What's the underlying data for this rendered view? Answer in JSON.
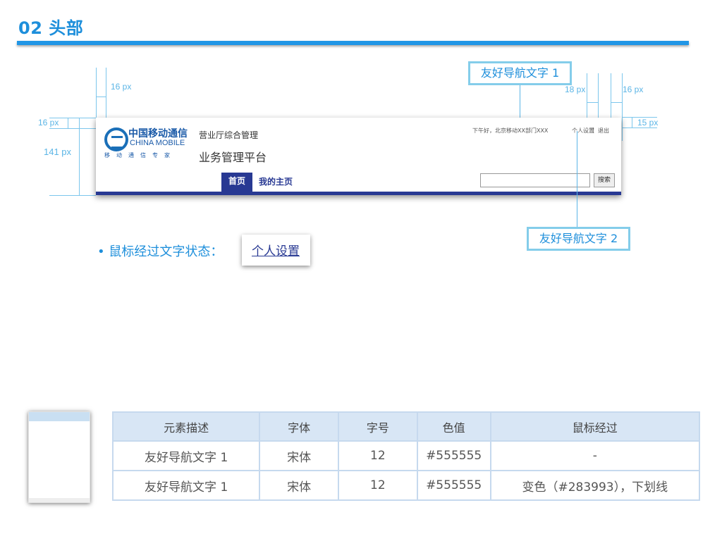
{
  "section": {
    "title": "02 头部"
  },
  "measurements": {
    "left_gap": "16 px",
    "top_gap": "16 px",
    "header_height": "141 px",
    "sep_gap": "18 px",
    "right_gap": "16 px",
    "right_top_gap": "15 px"
  },
  "callouts": {
    "friendly_nav_1": "友好导航文字 1",
    "friendly_nav_2": "友好导航文字 2"
  },
  "mock_header": {
    "logo_cn": "中国移动通信",
    "logo_en": "CHINA MOBILE",
    "logo_sub": "移动通信专家",
    "subtitle": "营业厅综合管理",
    "title": "业务管理平台",
    "nav": [
      "首页",
      "我的主页"
    ],
    "greeting": "下午好，北京移动XX部门XXX",
    "settings": "个人设置",
    "sep": "|",
    "logout": "退出",
    "search_button": "搜索"
  },
  "hover_demo": {
    "label": "• 鼠标经过文字状态：",
    "sample": "个人设置"
  },
  "spec_table": {
    "headers": [
      "元素描述",
      "字体",
      "字号",
      "色值",
      "鼠标经过"
    ],
    "rows": [
      [
        "友好导航文字 1",
        "宋体",
        "12",
        "#555555",
        "-"
      ],
      [
        "友好导航文字 1",
        "宋体",
        "12",
        "#555555",
        "变色（#283993），下划线"
      ]
    ]
  },
  "colors": {
    "accent": "#1e8fdb",
    "nav": "#283993",
    "text": "#555555",
    "table_header": "#d8e6f5"
  }
}
